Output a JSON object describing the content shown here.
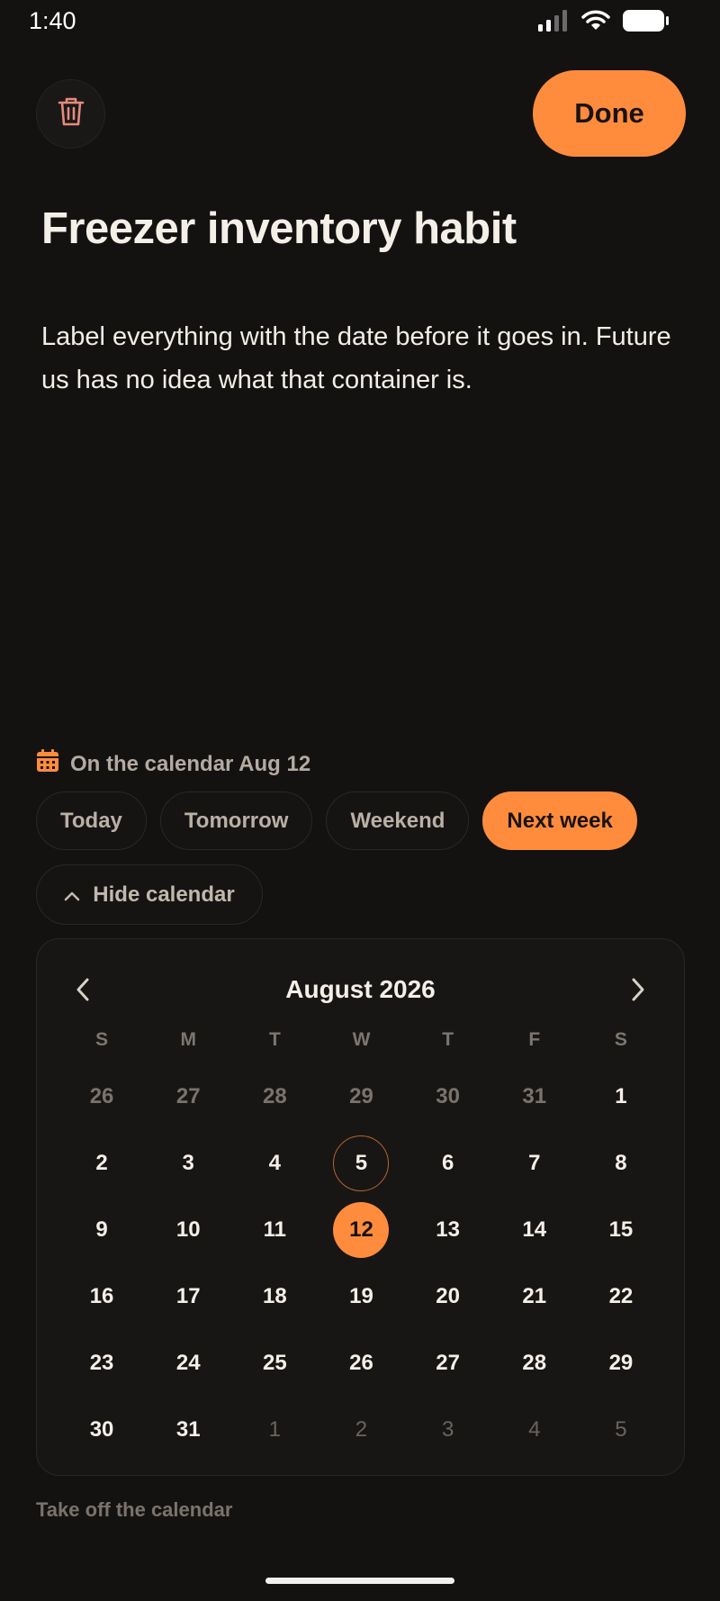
{
  "status": {
    "time": "1:40"
  },
  "header": {
    "done_label": "Done"
  },
  "note": {
    "title": "Freezer inventory habit",
    "body": "Label everything with the date before it goes in. Future us has no idea what that container is."
  },
  "schedule": {
    "label": "On the calendar Aug 12",
    "chips": [
      "Today",
      "Tomorrow",
      "Weekend",
      "Next week"
    ],
    "active_chip": "Next week",
    "hide_label": "Hide calendar",
    "take_off_label": "Take off the calendar"
  },
  "calendar": {
    "month": "August 2026",
    "weekdays": [
      "S",
      "M",
      "T",
      "W",
      "T",
      "F",
      "S"
    ],
    "leading": [
      "26",
      "27",
      "28",
      "29",
      "30",
      "31"
    ],
    "days_in_month": 31,
    "trailing": [
      "1",
      "2",
      "3",
      "4",
      "5"
    ],
    "today": 5,
    "selected": 12
  },
  "colors": {
    "accent": "#ff8c3d",
    "background": "#141211"
  }
}
